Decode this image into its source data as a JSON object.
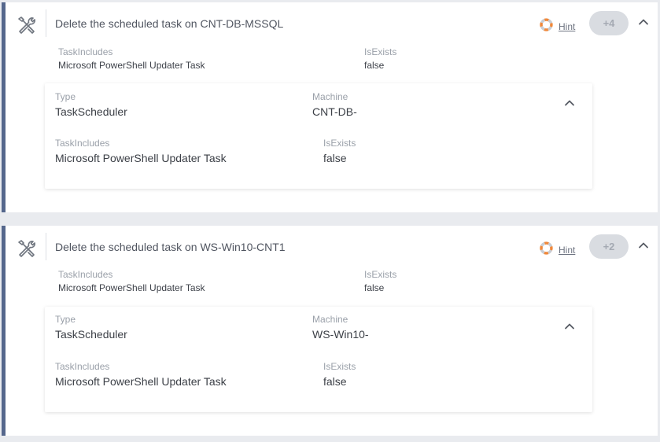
{
  "tasks": [
    {
      "title": "Delete the scheduled task on CNT-DB-MSSQL",
      "hint_label": "Hint",
      "badge": "+4",
      "summary": {
        "taskincludes_label": "TaskIncludes",
        "taskincludes_value": "Microsoft PowerShell Updater Task",
        "isexists_label": "IsExists",
        "isexists_value": "false"
      },
      "details": {
        "type_label": "Type",
        "type_value": "TaskScheduler",
        "machine_label": "Machine",
        "machine_value": "CNT-DB-",
        "taskincludes_label": "TaskIncludes",
        "taskincludes_value": "Microsoft PowerShell Updater Task",
        "isexists_label": "IsExists",
        "isexists_value": "false"
      }
    },
    {
      "title": "Delete the scheduled task on WS-Win10-CNT1",
      "hint_label": "Hint",
      "badge": "+2",
      "summary": {
        "taskincludes_label": "TaskIncludes",
        "taskincludes_value": "Microsoft PowerShell Updater Task",
        "isexists_label": "IsExists",
        "isexists_value": "false"
      },
      "details": {
        "type_label": "Type",
        "type_value": "TaskScheduler",
        "machine_label": "Machine",
        "machine_value": "WS-Win10-",
        "taskincludes_label": "TaskIncludes",
        "taskincludes_value": "Microsoft PowerShell Updater Task",
        "isexists_label": "IsExists",
        "isexists_value": "false"
      }
    }
  ],
  "icons": {
    "task": "tools-icon",
    "hint": "lifebuoy-icon",
    "collapse": "chevron-up-icon"
  },
  "colors": {
    "accent_border": "#55678c",
    "hint_orange": "#f0883a",
    "badge_bg": "#d9dce1"
  }
}
